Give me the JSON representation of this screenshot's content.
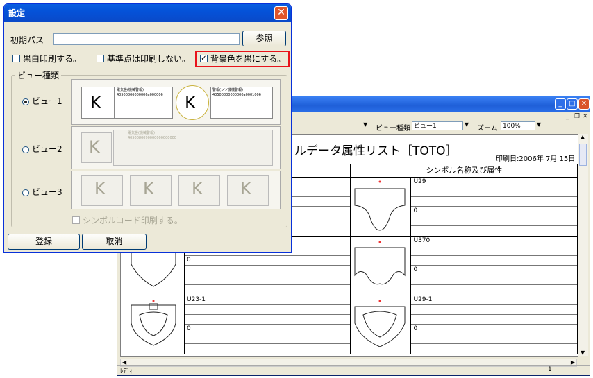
{
  "dialog": {
    "title": "設定",
    "close_glyph": "✕",
    "path_label": "初期パス",
    "path_value": "",
    "browse_button": "参照",
    "checkbox_bw": "黒白印刷する。",
    "checkbox_ref": "基準点は印刷しない。",
    "checkbox_bg": "背景色を黒にする。",
    "checkbox_bg_checked": true,
    "view_group": "ビュー種類",
    "view1": "ビュー1",
    "view2": "ビュー2",
    "view3": "ビュー3",
    "selected_view": "ビュー1",
    "symbol_code_checkbox": "シンボルコード印刷する。",
    "register_button": "登録",
    "cancel_button": "取消",
    "preview1_line1": "電気設(機械警報)",
    "preview1_line2": "40500806000006a000006",
    "preview1b_line1": "警報(ンツ機械警報)",
    "preview1b_line2": "40500800000000a0001006",
    "preview2_line1": "電気設(機械警報)",
    "preview2_line2": "4050080090000000000000",
    "k_letter": "K"
  },
  "background_window": {
    "view_type_label": "ビュー種類",
    "view_type_value": "ビュー1",
    "zoom_label": "ズーム",
    "zoom_value": "100%",
    "doc_title": "ルデータ属性リスト［TOTO］",
    "print_date": "印刷日:2006年 7月 15日",
    "column_header": "シンボル名称及び属性",
    "status_text": "ﾚﾃﾞｨ",
    "status_page": "1",
    "rows": [
      {
        "left_code": "",
        "left_attr": "",
        "right_code": "U29",
        "right_attr": "0"
      },
      {
        "left_code": "",
        "left_attr": "0",
        "right_code": "U370",
        "right_attr": "0"
      },
      {
        "left_code": "U23-1",
        "left_attr": "0",
        "right_code": "U29-1",
        "right_attr": "0"
      }
    ]
  }
}
